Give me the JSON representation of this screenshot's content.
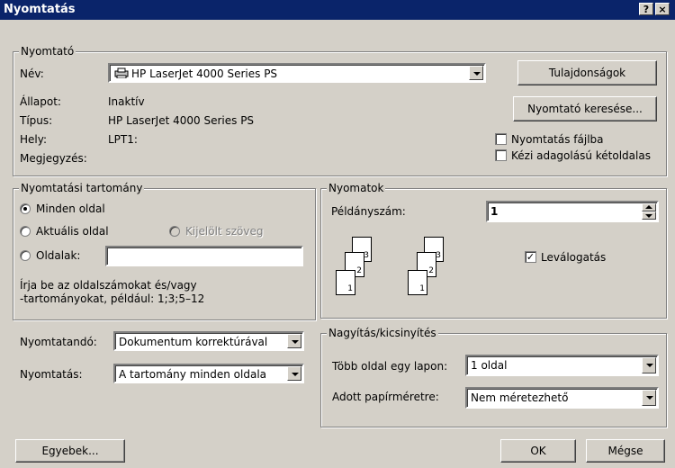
{
  "window": {
    "title": "Nyomtatás",
    "help_glyph": "?",
    "close_glyph": "×"
  },
  "printer": {
    "group_label": "Nyomtató",
    "name_label": "Név:",
    "name_value": "HP LaserJet 4000 Series PS",
    "status_label": "Állapot:",
    "status_value": "Inaktív",
    "type_label": "Típus:",
    "type_value": "HP LaserJet 4000 Series PS",
    "location_label": "Hely:",
    "location_value": "LPT1:",
    "comment_label": "Megjegyzés:",
    "properties_button": "Tulajdonságok",
    "find_button": "Nyomtató keresése...",
    "print_to_file": "Nyomtatás fájlba",
    "manual_duplex": "Kézi adagolású kétoldalas",
    "print_to_file_checked": false,
    "manual_duplex_checked": false
  },
  "range": {
    "group_label": "Nyomtatási tartomány",
    "all_pages": "Minden oldal",
    "current_page": "Aktuális oldal",
    "selection": "Kijelölt szöveg",
    "pages_label": "Oldalak:",
    "pages_value": "",
    "selected": "all_pages",
    "hint_line1": "Írja be az oldalszámokat és/vagy",
    "hint_line2": "-tartományokat, például: 1;3;5–12"
  },
  "copies": {
    "group_label": "Nyomatok",
    "count_label": "Példányszám:",
    "count_value": "1",
    "collate_label": "Leválogatás",
    "collate_checked": true,
    "page_numbers": [
      "3",
      "2",
      "1",
      "3",
      "2",
      "1"
    ]
  },
  "print_what": {
    "label": "Nyomtatandó:",
    "value": "Dokumentum korrektúrával"
  },
  "print_pages": {
    "label": "Nyomtatás:",
    "value": "A tartomány minden oldala"
  },
  "zoom": {
    "group_label": "Nagyítás/kicsinyítés",
    "pages_per_sheet_label": "Több oldal egy lapon:",
    "pages_per_sheet_value": "1 oldal",
    "scale_label": "Adott papírméretre:",
    "scale_value": "Nem méretezhető"
  },
  "footer": {
    "options_button": "Egyebek...",
    "ok_button": "OK",
    "cancel_button": "Mégse"
  }
}
